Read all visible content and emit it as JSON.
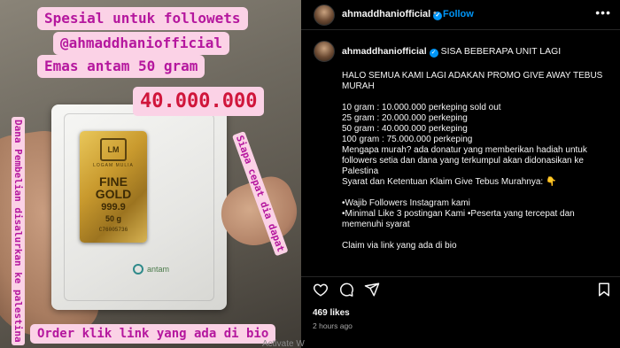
{
  "media": {
    "line1": "Spesial untuk followets",
    "line2": "@ahmaddhaniofficial",
    "line3": "Emas antam 50 gram",
    "price": "40.000.000",
    "left_vertical": "Dana Pembelian disalurkan ke palestina",
    "right_vertical": "Siapa cepat dia dapat",
    "order": "Order klik link yang ada di bio",
    "bar": {
      "logo": "LM",
      "maker": "LOGAM MULIA",
      "fine": "FINE",
      "gold": "GOLD",
      "purity": "999.9",
      "weight": "50 g",
      "serial": "C76005736"
    },
    "brand": "antam"
  },
  "header": {
    "username": "ahmaddhaniofficial",
    "separator": "•",
    "follow": "Follow",
    "more": "•••"
  },
  "caption": {
    "username": "ahmaddhaniofficial",
    "title": "SISA BEBERAPA UNIT LAGI",
    "lines": [
      "HALO SEMUA KAMI LAGI ADAKAN PROMO GIVE AWAY TEBUS MURAH",
      "",
      "10 gram : 10.000.000 perkeping sold out",
      "25 gram : 20.000.000 perkeping",
      "50 gram : 40.000.000 perkeping",
      "100 gram : 75.000.000 perkeping",
      "Mengapa murah? ada donatur yang memberikan hadiah untuk followers setia dan dana yang terkumpul akan didonasikan ke Palestina",
      "Syarat dan Ketentuan Klaim Give Tebus Murahnya: 👇",
      "",
      "•Wajib Followers Instagram kami",
      "•Minimal Like 3 postingan Kami •Peserta yang tercepat dan memenuhi syarat",
      "",
      "Claim via link yang ada di bio"
    ]
  },
  "actions": {
    "likes": "469 likes",
    "time": "2 hours ago"
  },
  "overlay": {
    "activate": "Activate W"
  },
  "icons": {
    "like": "heart-icon",
    "comment": "comment-icon",
    "share": "share-icon",
    "save": "bookmark-icon",
    "verified": "verified-badge-icon"
  },
  "colors": {
    "accent": "#0095f6",
    "text_pink": "#b5179e",
    "price_red": "#d0163b",
    "label_bg": "#fbd2e6"
  }
}
